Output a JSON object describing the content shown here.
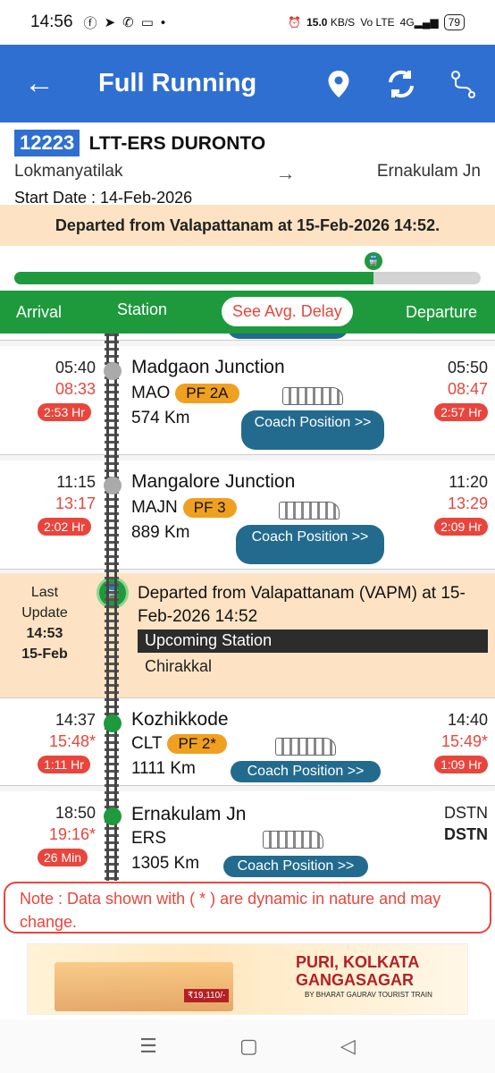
{
  "status_bar": {
    "time": "14:56",
    "net_speed": "15.0",
    "net_unit": "KB/S",
    "volte": "Vo LTE",
    "signal": "4G",
    "battery": "79"
  },
  "app_bar": {
    "title": "Full Running"
  },
  "train": {
    "number": "12223",
    "name": "LTT-ERS DURONTO",
    "from": "Lokmanyatilak",
    "arrow": "→",
    "to": "Ernakulam Jn",
    "start_date": "Start Date : 14-Feb-2026"
  },
  "banner": "Departed from Valapattanam at 15-Feb-2026 14:52.",
  "progress": {
    "fraction": 0.77
  },
  "tabs": {
    "arrival": "Arrival",
    "station": "Station",
    "avg_delay": "See Avg. Delay",
    "departure": "Departure"
  },
  "stations": [
    {
      "name": "Madgaon Junction",
      "code": "MAO",
      "pf": "PF 2A",
      "km": "574 Km",
      "arr_sched": "05:40",
      "arr_actual": "08:33",
      "arr_late": "2:53 Hr",
      "dep_sched": "05:50",
      "dep_actual": "08:47",
      "dep_late": "2:57 Hr",
      "coach_label": "Coach Position >>"
    },
    {
      "name": "Mangalore Junction",
      "code": "MAJN",
      "pf": "PF 3",
      "km": "889 Km",
      "arr_sched": "11:15",
      "arr_actual": "13:17",
      "arr_late": "2:02 Hr",
      "dep_sched": "11:20",
      "dep_actual": "13:29",
      "dep_late": "2:09 Hr",
      "coach_label": "Coach Position >>"
    },
    {
      "name": "Kozhikkode",
      "code": "CLT",
      "pf": "PF 2*",
      "km": "1111 Km",
      "arr_sched": "14:37",
      "arr_actual": "15:48*",
      "arr_late": "1:11 Hr",
      "dep_sched": "14:40",
      "dep_actual": "15:49*",
      "dep_late": "1:09 Hr",
      "coach_label": "Coach Position >>"
    },
    {
      "name": "Ernakulam Jn",
      "code": "ERS",
      "km": "1305 Km",
      "arr_sched": "18:50",
      "arr_actual": "19:16*",
      "arr_late": "26 Min",
      "dep_sched": "DSTN",
      "dep_actual": "DSTN",
      "coach_label": "Coach Position >>"
    }
  ],
  "last_update": {
    "label_line1": "Last",
    "label_line2": "Update",
    "time": "14:53",
    "date": "15-Feb",
    "message": "Departed from Valapattanam (VAPM) at 15-Feb-2026 14:52",
    "upcoming_label": "Upcoming Station",
    "upcoming_station": "Chirakkal"
  },
  "note": "Note : Data shown with ( * ) are dynamic in nature and may change.",
  "ad": {
    "title_line1": "PURI, KOLKATA",
    "title_line2": "GANGASAGAR",
    "subtitle": "BY BHARAT GAURAV TOURIST TRAIN",
    "price": "₹19,110/-"
  },
  "colors": {
    "primary": "#2f6fd1",
    "green": "#1e9a3d",
    "red": "#e8453c",
    "orange": "#f0a020",
    "coach_btn": "#236b8e",
    "banner_bg": "#fde3c3"
  }
}
